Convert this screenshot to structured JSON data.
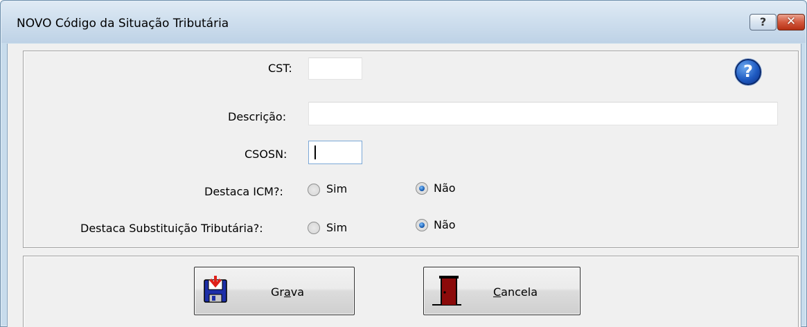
{
  "window": {
    "title": "NOVO Código da Situação Tributária",
    "help_caption": "?",
    "close_caption": "✕"
  },
  "form": {
    "cst_label": "CST:",
    "cst_value": "",
    "descricao_label": "Descrição:",
    "descricao_value": "",
    "csosn_label": "CSOSN:",
    "csosn_value": "",
    "destaca_icm_label": "Destaca ICM?:",
    "destaca_icm_options": [
      "Sim",
      "Não"
    ],
    "destaca_icm_selected": "Não",
    "destaca_st_label": "Destaca Substituição Tributária?:",
    "destaca_st_options": [
      "Sim",
      "Não"
    ],
    "destaca_st_selected": "Não",
    "help_icon_glyph": "?"
  },
  "buttons": {
    "gravar": {
      "prefix": "Gr",
      "accel": "a",
      "suffix": "va",
      "icon": "floppy-save-icon"
    },
    "cancelar": {
      "prefix": "",
      "accel": "C",
      "suffix": "ancela",
      "icon": "exit-door-icon"
    }
  },
  "colors": {
    "accent_blue": "#1f5bc2",
    "close_red": "#d3593e",
    "door_red": "#8b0a0a"
  }
}
